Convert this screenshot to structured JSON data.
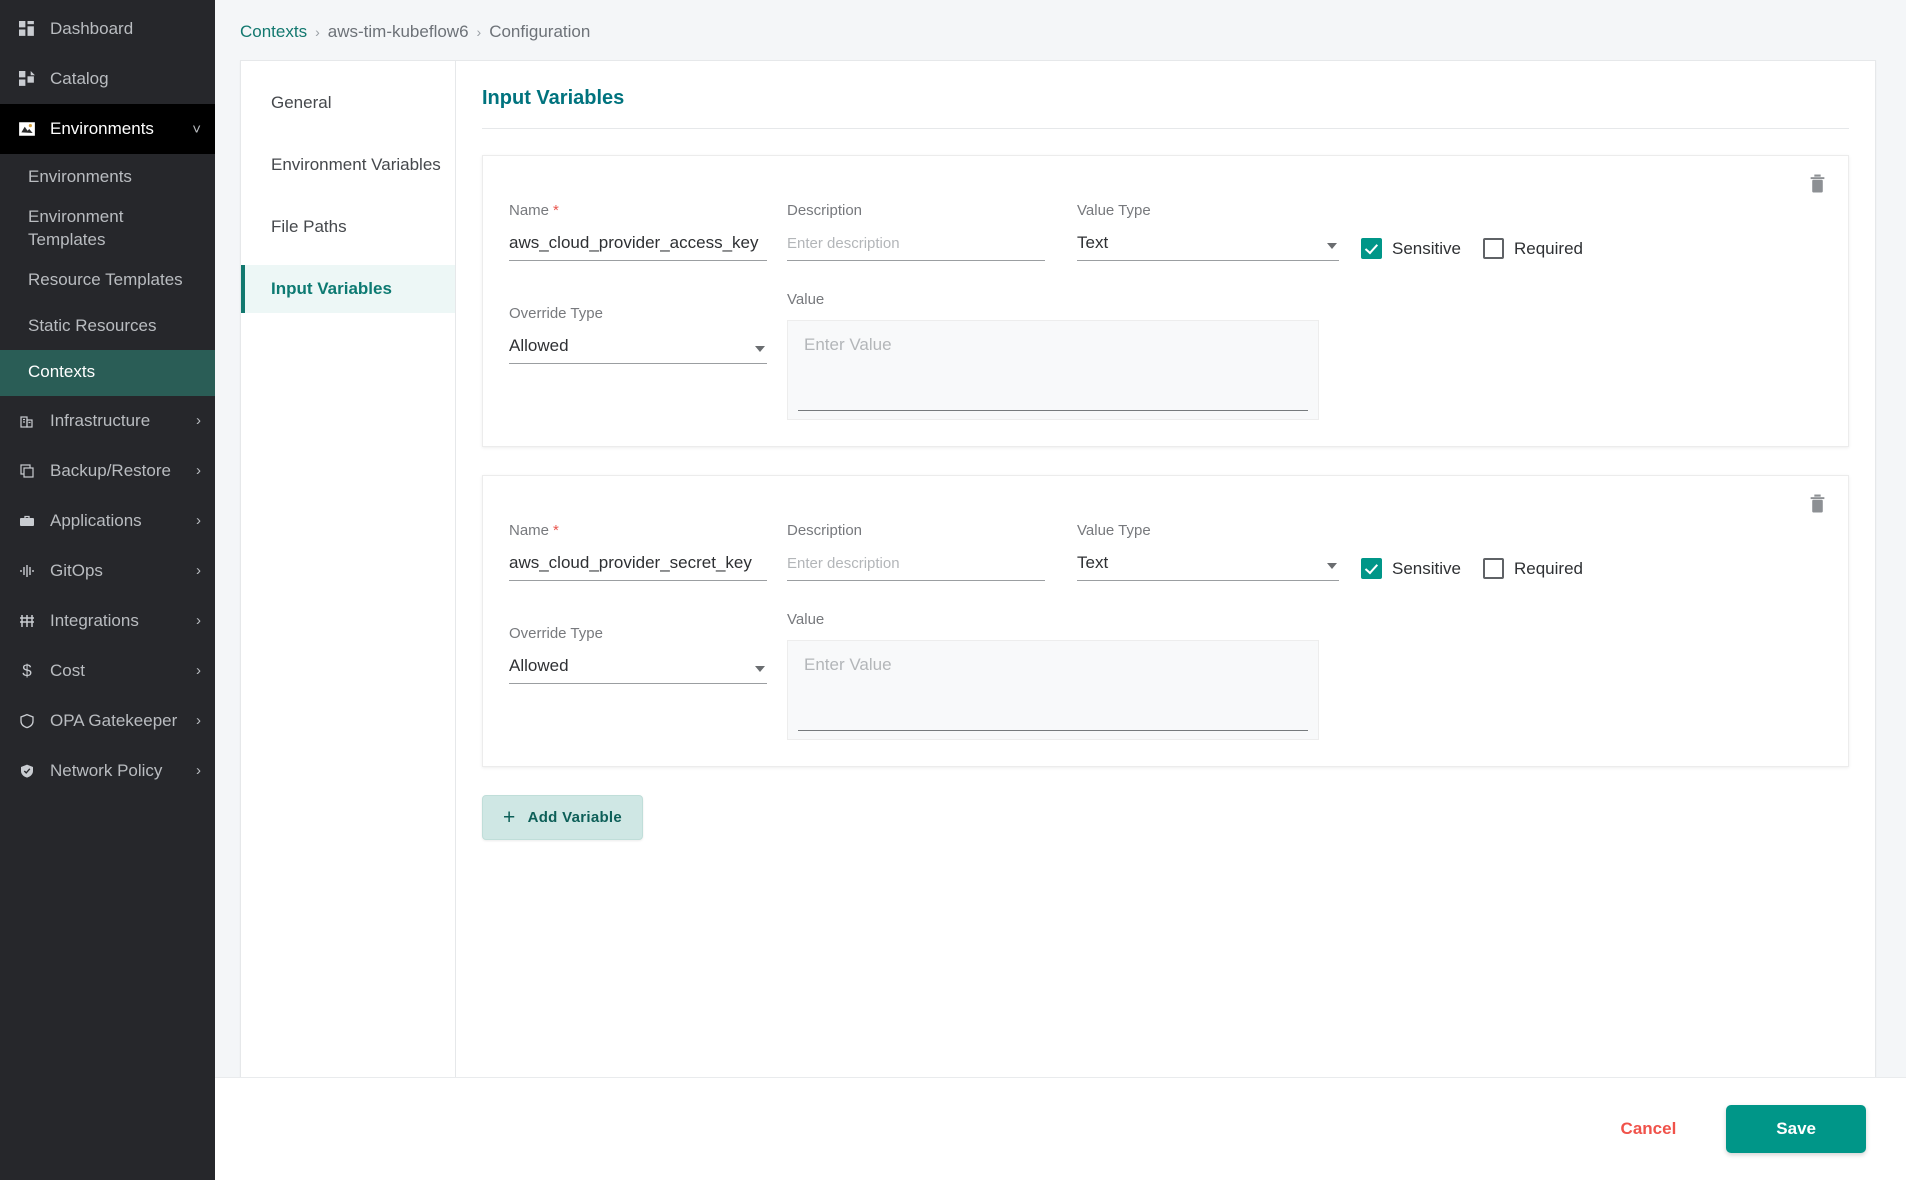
{
  "sidebar": {
    "items": [
      {
        "label": "Dashboard",
        "icon": "dashboard-icon",
        "type": "top",
        "state": "normal"
      },
      {
        "label": "Catalog",
        "icon": "catalog-icon",
        "type": "top",
        "state": "normal"
      },
      {
        "label": "Environments",
        "icon": "environments-icon",
        "type": "top",
        "state": "expanded",
        "chevron": "˅"
      }
    ],
    "sub_items": [
      {
        "label": "Environments",
        "active": false
      },
      {
        "label": "Environment Templates",
        "active": false
      },
      {
        "label": "Resource Templates",
        "active": false
      },
      {
        "label": "Static Resources",
        "active": false
      },
      {
        "label": "Contexts",
        "active": true
      }
    ],
    "bottom_items": [
      {
        "label": "Infrastructure",
        "icon": "building-icon",
        "chevron": "›"
      },
      {
        "label": "Backup/Restore",
        "icon": "copy-icon",
        "chevron": "›"
      },
      {
        "label": "Applications",
        "icon": "briefcase-icon",
        "chevron": "›"
      },
      {
        "label": "GitOps",
        "icon": "waveform-icon",
        "chevron": "›"
      },
      {
        "label": "Integrations",
        "icon": "sliders-icon",
        "chevron": "›"
      },
      {
        "label": "Cost",
        "icon": "dollar-icon",
        "chevron": "›"
      },
      {
        "label": "OPA Gatekeeper",
        "icon": "shield-icon",
        "chevron": "›"
      },
      {
        "label": "Network Policy",
        "icon": "shield-check-icon",
        "chevron": "›"
      }
    ]
  },
  "breadcrumb": {
    "root": "Contexts",
    "sep": "›",
    "middle": "aws-tim-kubeflow6",
    "current": "Configuration"
  },
  "tabs": [
    {
      "label": "General",
      "active": false
    },
    {
      "label": "Environment Variables",
      "active": false
    },
    {
      "label": "File Paths",
      "active": false
    },
    {
      "label": "Input Variables",
      "active": true
    }
  ],
  "content": {
    "title": "Input Variables",
    "labels": {
      "name": "Name",
      "required_star": "*",
      "description": "Description",
      "value_type": "Value Type",
      "override_type": "Override Type",
      "value": "Value",
      "sensitive": "Sensitive",
      "required": "Required"
    },
    "placeholders": {
      "description": "Enter description",
      "value": "Enter Value"
    }
  },
  "variables": [
    {
      "name": "aws_cloud_provider_access_key",
      "description": "",
      "value_type": "Text",
      "override_type": "Allowed",
      "value": "",
      "sensitive": true,
      "required": false
    },
    {
      "name": "aws_cloud_provider_secret_key",
      "description": "",
      "value_type": "Text",
      "override_type": "Allowed",
      "value": "",
      "sensitive": true,
      "required": false
    }
  ],
  "buttons": {
    "add_variable": "Add Variable",
    "add_plus": "+",
    "cancel": "Cancel",
    "save": "Save"
  },
  "colors": {
    "accent_teal": "#009688",
    "heading_teal": "#00737e",
    "link_teal": "#12786f",
    "sidebar_active": "#2a5d56",
    "cancel_red": "#f0524a",
    "add_btn_bg": "#cfe7e4"
  }
}
